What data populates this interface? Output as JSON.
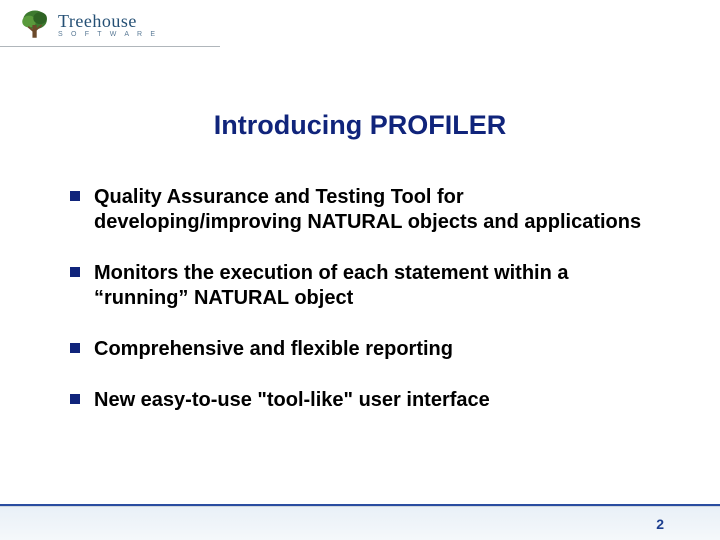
{
  "logo": {
    "brand": "Treehouse",
    "subline": "S O F T W A R E"
  },
  "title": "Introducing PROFILER",
  "bullets": [
    "Quality Assurance and Testing Tool for developing/improving NATURAL objects and applications",
    "Monitors the execution of each statement within a “running” NATURAL object",
    "Comprehensive and flexible reporting",
    "New easy-to-use \"tool-like\" user interface"
  ],
  "page_number": "2",
  "colors": {
    "title": "#10247b",
    "bullet": "#10247b",
    "text": "#000000"
  }
}
